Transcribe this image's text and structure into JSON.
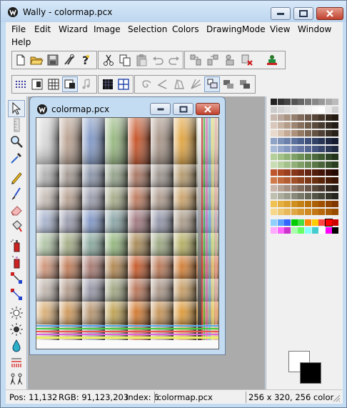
{
  "window": {
    "title": "Wally - colormap.pcx"
  },
  "menu": [
    "File",
    "Edit",
    "Wizard",
    "Image",
    "Selection",
    "Colors",
    "DrawingMode",
    "View",
    "Window",
    "Help"
  ],
  "toolbar1_icons": [
    "new-file-icon",
    "open-folder-icon",
    "save-disk-icon",
    "tools-icon",
    "help-icon",
    "cut-scissors-icon",
    "copy-icon",
    "paste-icon",
    "undo-icon",
    "redo-icon",
    "rotate-icon",
    "flip-icon",
    "transform-icon",
    "delete-icon",
    "green-figure-icon"
  ],
  "toolbar2_icons": [
    "grid-dots-icon",
    "window-tile-icon",
    "table-grid-icon",
    "window-icon",
    "music-note-icon",
    "dark-grid-icon",
    "blue-grid-icon",
    "spiral-icon",
    "angle-icon",
    "shape-icon",
    "fan-icon",
    "mode-one-icon",
    "mode-two-icon",
    "mode-three-icon"
  ],
  "tools": [
    "select-arrow-icon",
    "ruler-icon",
    "magnifier-icon",
    "eyedropper-icon",
    "pencil-icon",
    "brush-icon",
    "eraser-icon",
    "fill-bucket-icon",
    "spray-icon",
    "spray-plus-icon",
    "swap-colors-icon",
    "line-icon",
    "sun-icon",
    "sun-outline-icon",
    "drop-icon",
    "fountain-icon",
    "figures-icon"
  ],
  "child": {
    "title": "colormap.pcx"
  },
  "status": {
    "pos": "Pos: 11,132",
    "rgb": "RGB: 91,123,203",
    "index": "Index: 6",
    "file": "colormap.pcx",
    "size": "256 x 320, 256 color"
  },
  "palette_colors": [
    "#222222",
    "#333333",
    "#444444",
    "#555555",
    "#666666",
    "#777777",
    "#888888",
    "#999999",
    "#aaaaaa",
    "#bbbbbb",
    "#cccccc",
    "#d4d4d4",
    "#dddddd",
    "#e6e6e6",
    "#eeeeee",
    "#f4f4f4",
    "#fafafa",
    "#ffffff",
    "#e8e8e8",
    "#d0d0d0",
    "#c9b8ae",
    "#bba89c",
    "#a99484",
    "#957f6f",
    "#7f6a5b",
    "#6a5749",
    "#564538",
    "#433529",
    "#33271d",
    "#231a12",
    "#d8c7ba",
    "#c8b3a3",
    "#b39c8a",
    "#9d8571",
    "#86705d",
    "#6f5c4b",
    "#5a4a3c",
    "#46392e",
    "#342a21",
    "#231b15",
    "#e9d9cc",
    "#d8c2b0",
    "#c4aa94",
    "#ad917b",
    "#947a64",
    "#7b6553",
    "#645243",
    "#4e4034",
    "#3a3026",
    "#28211a",
    "#8fa3c6",
    "#7d92b9",
    "#6b80ab",
    "#5a6f9c",
    "#4b5f8c",
    "#3e507a",
    "#324267",
    "#273454",
    "#1d2742",
    "#141b30",
    "#a7bad8",
    "#96a9cd",
    "#8598c1",
    "#7587b3",
    "#6576a4",
    "#566693",
    "#475680",
    "#39466b",
    "#2c3756",
    "#1f2840",
    "#b4cf9a",
    "#a3c289",
    "#91b277",
    "#7fa167",
    "#6d8f58",
    "#5c7d4a",
    "#4c6a3d",
    "#3d5731",
    "#2f4426",
    "#22321b",
    "#c9ddb4",
    "#b7d09f",
    "#a4c08b",
    "#91af78",
    "#7e9d67",
    "#6c8a57",
    "#5a7748",
    "#49643a",
    "#39512d",
    "#2a3e21",
    "#c0562b",
    "#ad4b25",
    "#9a401f",
    "#87361a",
    "#752d15",
    "#632411",
    "#521c0d",
    "#421509",
    "#330f06",
    "#250a03",
    "#d07a4a",
    "#c26b3d",
    "#b25c31",
    "#a14f27",
    "#8f431e",
    "#7c3816",
    "#6a2e10",
    "#58250b",
    "#471c07",
    "#371404",
    "#c8b4a8",
    "#b8a294",
    "#a68f80",
    "#937c6d",
    "#7f695b",
    "#6b574a",
    "#58473b",
    "#46382e",
    "#352a22",
    "#261e17",
    "#bfbfb0",
    "#aeae9e",
    "#9c9c8c",
    "#8a8a7a",
    "#787868",
    "#666657",
    "#555547",
    "#444438",
    "#34342a",
    "#25251d",
    "#f0c050",
    "#e6b040",
    "#dca030",
    "#d09020",
    "#c48014",
    "#b8700a",
    "#ac6004",
    "#a05000",
    "#904400",
    "#803800",
    "#f6d888",
    "#efc870",
    "#e8b858",
    "#e0a844",
    "#d89830",
    "#d08820",
    "#c47814",
    "#b8680a",
    "#a85a04",
    "#984c00",
    "#8fd0ff",
    "#5aa0ff",
    "#3366ff",
    "#00cc00",
    "#44dd44",
    "#ff8800",
    "#ffcc00",
    "#ff4444",
    "#ff0000",
    "#cc0000",
    "#ffaaff",
    "#ff66ff",
    "#cc33cc",
    "#aaffaa",
    "#66ff66",
    "#88ffff",
    "#44cccc",
    "#ffffff",
    "#ff00ff",
    "#000000"
  ],
  "fg_color": "#000000",
  "bg_color": "#ffffff"
}
